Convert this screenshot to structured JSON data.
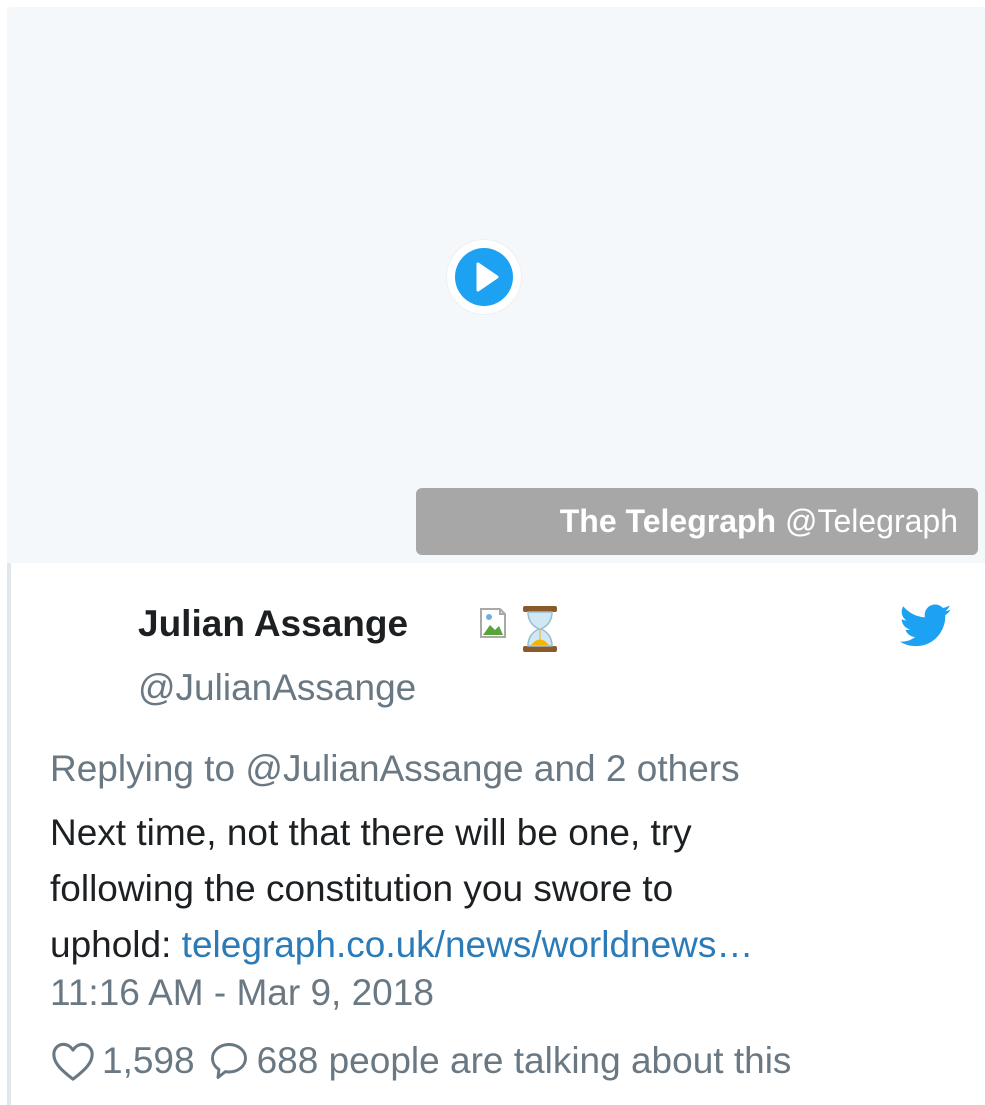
{
  "media": {
    "play_icon": "play-icon",
    "source_name": "The Telegraph",
    "source_handle": "@Telegraph"
  },
  "tweet": {
    "author_name": "Julian Assange",
    "author_handle": "@JulianAssange",
    "badges": [
      "broken-image-icon",
      "hourglass-icon"
    ],
    "reply_to": "Replying to @JulianAssange and 2 others",
    "text_line1": "Next time, not that there will be one, try",
    "text_line2": "following the constitution you swore to",
    "text_line3_prefix": "uphold: ",
    "link_text": "telegraph.co.uk/news/worldnews…",
    "timestamp": "11:16 AM - Mar 9, 2018",
    "likes": "1,598",
    "talking": "688 people are talking about this"
  },
  "colors": {
    "media_bg": "#f5f8fa",
    "twitter_blue": "#1da1f2",
    "link": "#2b7bb9",
    "text": "#1c2022",
    "secondary": "#697882"
  }
}
